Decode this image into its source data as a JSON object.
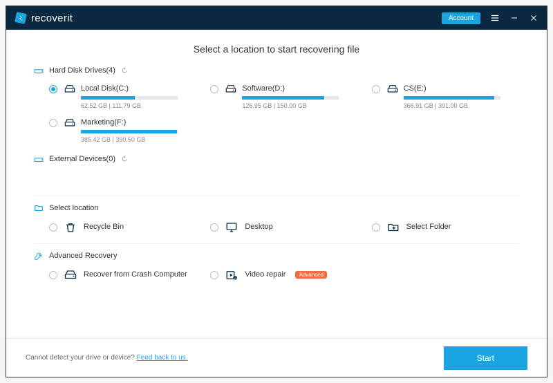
{
  "titlebar": {
    "brand": "recoverit",
    "account_label": "Account"
  },
  "heading": "Select a location to start recovering file",
  "sections": {
    "hdd": {
      "label": "Hard Disk Drives(4)",
      "drives": [
        {
          "name": "Local Disk(C:)",
          "used": "62.52",
          "total": "111.79",
          "unit": "GB",
          "percent": 56,
          "selected": true
        },
        {
          "name": "Software(D:)",
          "used": "126.95",
          "total": "150.00",
          "unit": "GB",
          "percent": 85,
          "selected": false
        },
        {
          "name": "CS(E:)",
          "used": "366.91",
          "total": "391.00",
          "unit": "GB",
          "percent": 94,
          "selected": false
        },
        {
          "name": "Marketing(F:)",
          "used": "385.42",
          "total": "390.50",
          "unit": "GB",
          "percent": 99,
          "selected": false
        }
      ]
    },
    "external": {
      "label": "External Devices(0)"
    },
    "select_location": {
      "label": "Select location",
      "items": [
        {
          "name": "Recycle Bin",
          "icon": "recyclebin"
        },
        {
          "name": "Desktop",
          "icon": "desktop"
        },
        {
          "name": "Select Folder",
          "icon": "folder"
        }
      ]
    },
    "advanced": {
      "label": "Advanced Recovery",
      "items": [
        {
          "name": "Recover from Crash Computer",
          "icon": "drive",
          "badge": null
        },
        {
          "name": "Video repair",
          "icon": "videorepair",
          "badge": "Advanced"
        }
      ]
    }
  },
  "footer": {
    "text": "Cannot detect your drive or device? ",
    "link": "Feed back to us.",
    "start": "Start"
  }
}
